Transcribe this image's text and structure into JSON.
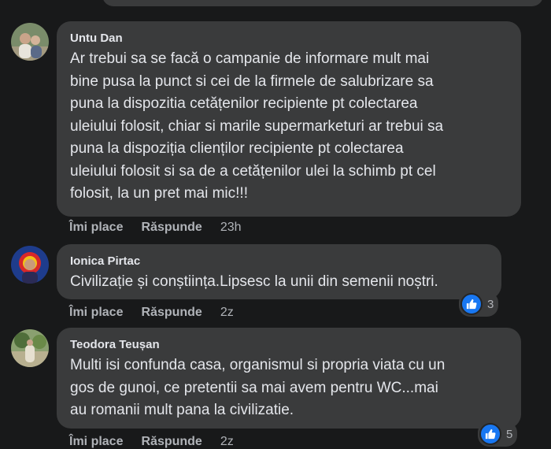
{
  "actions": {
    "like_label": "Îmi place",
    "reply_label": "Răspunde"
  },
  "comments": [
    {
      "author": "Untu Dan",
      "text": "Ar trebui sa se facă o campanie de informare mult mai\nbine pusa la punct si cei de la firmele de salubrizare sa\npuna la dispozitia cetățenilor recipiente pt colectarea\nuleiului folosit, chiar si marile supermarketuri ar trebui sa\npuna la dispoziția clienților recipiente pt colectarea\nuleiului folosit si sa de a cetățenilor ulei la schimb pt cel\nfolosit, la un pret mai mic!!!",
      "time": "23h"
    },
    {
      "author": "Ionica Pirtac",
      "text": "Civilizație și conștiința.Lipsesc la unii din semenii noștri.",
      "time": "2z",
      "reactions": "3"
    },
    {
      "author": "Teodora Teușan",
      "text": "Multi isi confunda casa, organismul si propria viata cu un\ngos de gunoi, ce pretentii sa mai avem pentru WC...mai\nau romanii mult pana la civilizatie.",
      "time": "2z",
      "reactions": "5"
    }
  ],
  "colors": {
    "background": "#18191a",
    "bubble": "#3a3b3c",
    "like_blue": "#1877f2",
    "secondary_text": "#b0b3b8"
  }
}
